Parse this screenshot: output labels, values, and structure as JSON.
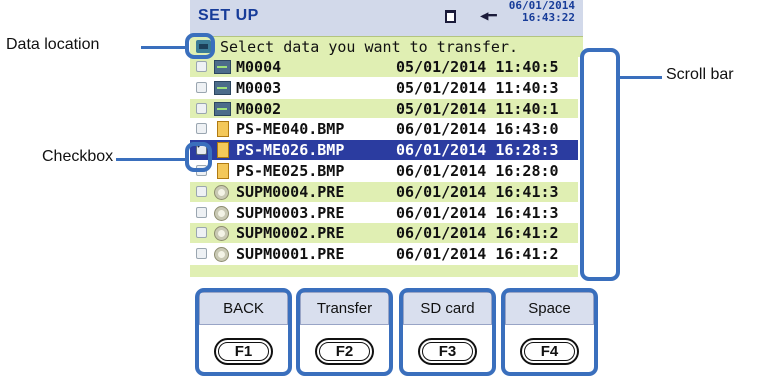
{
  "header": {
    "title": "SET UP",
    "date": "06/01/2014",
    "time": "16:43:22",
    "icons": [
      "sd-card-icon",
      "power-plug-icon"
    ]
  },
  "prompt": {
    "text": "Select data you want to transfer."
  },
  "files": [
    {
      "name": "M0004",
      "date": "05/01/2014 11:40:5",
      "type": "measurement",
      "checked": false,
      "selected": false
    },
    {
      "name": "M0003",
      "date": "05/01/2014 11:40:3",
      "type": "measurement",
      "checked": false,
      "selected": false
    },
    {
      "name": "M0002",
      "date": "05/01/2014 11:40:1",
      "type": "measurement",
      "checked": false,
      "selected": false
    },
    {
      "name": "PS-ME040.BMP",
      "date": "06/01/2014 16:43:0",
      "type": "bmp",
      "checked": false,
      "selected": false
    },
    {
      "name": "PS-ME026.BMP",
      "date": "06/01/2014 16:28:3",
      "type": "bmp",
      "checked": true,
      "selected": true
    },
    {
      "name": "PS-ME025.BMP",
      "date": "06/01/2014 16:28:0",
      "type": "bmp",
      "checked": false,
      "selected": false
    },
    {
      "name": "SUPM0004.PRE",
      "date": "06/01/2014 16:41:3",
      "type": "preset",
      "checked": false,
      "selected": false
    },
    {
      "name": "SUPM0003.PRE",
      "date": "06/01/2014 16:41:3",
      "type": "preset",
      "checked": false,
      "selected": false
    },
    {
      "name": "SUPM0002.PRE",
      "date": "06/01/2014 16:41:2",
      "type": "preset",
      "checked": false,
      "selected": false
    },
    {
      "name": "SUPM0001.PRE",
      "date": "06/01/2014 16:41:2",
      "type": "preset",
      "checked": false,
      "selected": false
    }
  ],
  "function_keys": [
    {
      "label": "BACK",
      "key": "F1"
    },
    {
      "label": "Transfer",
      "key": "F2"
    },
    {
      "label": "SD card",
      "key": "F3"
    },
    {
      "label": "Space",
      "key": "F4"
    }
  ],
  "callouts": {
    "data_location": "Data location",
    "checkbox": "Checkbox",
    "scroll_bar": "Scroll bar"
  },
  "colors": {
    "highlight": "#3a6fbd",
    "row_alt": "#e0efb3",
    "selected_row": "#2b3ca0",
    "title": "#173c99",
    "scroll_thumb": "#6cc54a"
  }
}
